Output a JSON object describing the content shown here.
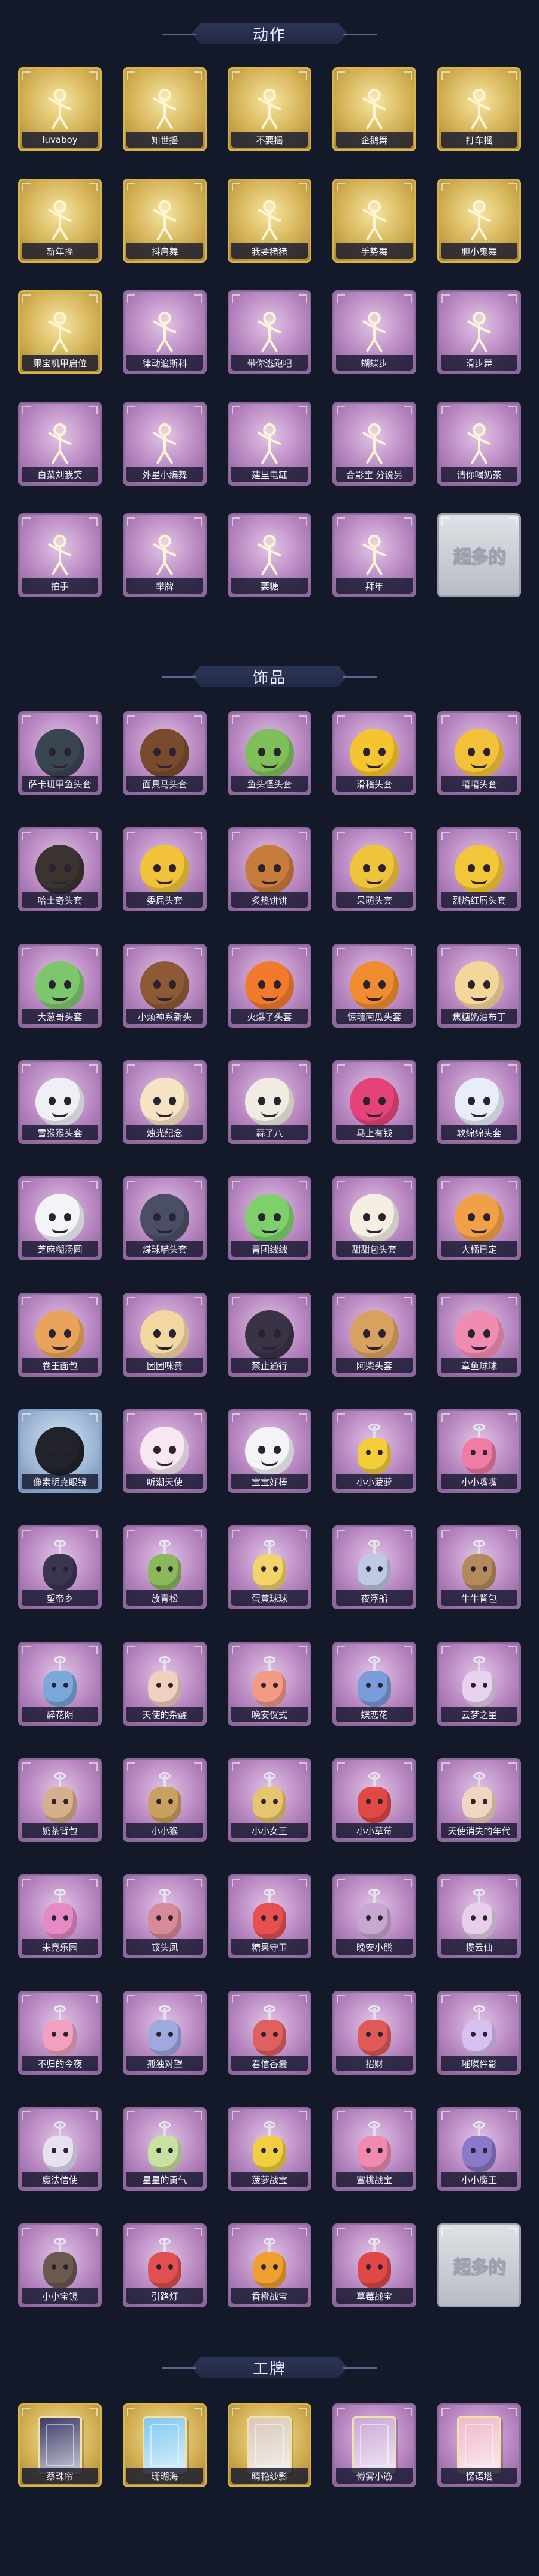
{
  "sections": {
    "actions": {
      "title": "动作",
      "items": [
        {
          "label": "luvaboy",
          "style": "gold",
          "icon": "figure-icon"
        },
        {
          "label": "知世摇",
          "style": "gold",
          "icon": "figure-icon"
        },
        {
          "label": "不要摇",
          "style": "gold",
          "icon": "figure-icon"
        },
        {
          "label": "企鹅舞",
          "style": "gold",
          "icon": "figure-icon"
        },
        {
          "label": "打车摇",
          "style": "gold",
          "icon": "figure-icon"
        },
        {
          "label": "新年摇",
          "style": "gold",
          "icon": "figure-icon"
        },
        {
          "label": "抖肩舞",
          "style": "gold",
          "icon": "figure-icon"
        },
        {
          "label": "我要猪猪",
          "style": "gold",
          "icon": "figure-icon"
        },
        {
          "label": "手势舞",
          "style": "gold",
          "icon": "figure-icon"
        },
        {
          "label": "胆小鬼舞",
          "style": "gold",
          "icon": "figure-icon"
        },
        {
          "label": "果宝机甲启位",
          "style": "gold",
          "icon": "figure-icon"
        },
        {
          "label": "律动追斯科",
          "style": "purple",
          "icon": "figure-icon"
        },
        {
          "label": "带你逃跑吧",
          "style": "purple",
          "icon": "figure-icon"
        },
        {
          "label": "蝴蝶步",
          "style": "purple",
          "icon": "figure-icon"
        },
        {
          "label": "滑步舞",
          "style": "purple",
          "icon": "figure-icon"
        },
        {
          "label": "白菜刘我笑",
          "style": "purple",
          "icon": "figure-icon"
        },
        {
          "label": "外星小编舞",
          "style": "purple",
          "icon": "figure-icon"
        },
        {
          "label": "建里电缸",
          "style": "purple",
          "icon": "figure-icon"
        },
        {
          "label": "合影宝 分说另",
          "style": "purple",
          "icon": "figure-icon"
        },
        {
          "label": "请你喝奶茶",
          "style": "purple",
          "icon": "figure-icon"
        },
        {
          "label": "拍手",
          "style": "purple",
          "icon": "figure-icon"
        },
        {
          "label": "举牌",
          "style": "purple",
          "icon": "figure-icon"
        },
        {
          "label": "要糖",
          "style": "purple",
          "icon": "figure-icon"
        },
        {
          "label": "拜年",
          "style": "purple",
          "icon": "figure-icon"
        },
        {
          "label": "",
          "style": "placeholder",
          "icon": "placeholder",
          "placeholder_text": "超多的"
        }
      ]
    },
    "accessories": {
      "title": "饰品",
      "items": [
        {
          "label": "萨卡班甲鱼头套",
          "style": "purple",
          "icon": "head",
          "color": "#3a4552"
        },
        {
          "label": "面具马头套",
          "style": "purple",
          "icon": "head",
          "color": "#7a4a2e"
        },
        {
          "label": "鱼头怪头套",
          "style": "purple",
          "icon": "head",
          "color": "#7fbf5a"
        },
        {
          "label": "滑稽头套",
          "style": "purple",
          "icon": "head",
          "color": "#f4c531"
        },
        {
          "label": "嘻嘻头套",
          "style": "purple",
          "icon": "head",
          "color": "#f2c23a"
        },
        {
          "label": "哈士奇头套",
          "style": "purple",
          "icon": "head",
          "color": "#3b3330"
        },
        {
          "label": "委屈头套",
          "style": "purple",
          "icon": "head",
          "color": "#f1c23a"
        },
        {
          "label": "炙热饼饼",
          "style": "purple",
          "icon": "head",
          "color": "#c77b3c"
        },
        {
          "label": "呆萌头套",
          "style": "purple",
          "icon": "head",
          "color": "#f0c33c"
        },
        {
          "label": "烈焰红唇头套",
          "style": "purple",
          "icon": "head",
          "color": "#f3c63a"
        },
        {
          "label": "大葱哥头套",
          "style": "purple",
          "icon": "head",
          "color": "#7ec66b"
        },
        {
          "label": "小烦神系新头",
          "style": "purple",
          "icon": "head",
          "color": "#8e5a36"
        },
        {
          "label": "火爆了头套",
          "style": "purple",
          "icon": "head",
          "color": "#f17a2c"
        },
        {
          "label": "惊魂南瓜头套",
          "style": "purple",
          "icon": "head",
          "color": "#ee8c2f"
        },
        {
          "label": "焦糖奶油布丁",
          "style": "purple",
          "icon": "head",
          "color": "#f4d59a"
        },
        {
          "label": "雪猴猴头套",
          "style": "purple",
          "icon": "head",
          "color": "#eef0f5"
        },
        {
          "label": "烛光纪念",
          "style": "purple",
          "icon": "head",
          "color": "#f6e3c4"
        },
        {
          "label": "蒜了八",
          "style": "purple",
          "icon": "head",
          "color": "#f1ece1"
        },
        {
          "label": "马上有钱",
          "style": "purple",
          "icon": "head",
          "color": "#e6427a"
        },
        {
          "label": "软绵绵头套",
          "style": "purple",
          "icon": "head",
          "color": "#e8eef8"
        },
        {
          "label": "芝麻糊汤圆",
          "style": "purple",
          "icon": "head",
          "color": "#f2f4f8"
        },
        {
          "label": "煤球喵头套",
          "style": "purple",
          "icon": "head",
          "color": "#4a4f66"
        },
        {
          "label": "青团绒绒",
          "style": "purple",
          "icon": "head",
          "color": "#7ed16a"
        },
        {
          "label": "甜甜包头套",
          "style": "purple",
          "icon": "head",
          "color": "#f4efe0"
        },
        {
          "label": "大橘已定",
          "style": "purple",
          "icon": "head",
          "color": "#f0a048"
        },
        {
          "label": "卷王面包",
          "style": "purple",
          "icon": "head",
          "color": "#e9a35a"
        },
        {
          "label": "团团咪黄",
          "style": "purple",
          "icon": "head",
          "color": "#f3d7a1"
        },
        {
          "label": "禁止通行",
          "style": "purple",
          "icon": "head",
          "color": "#3a3346"
        },
        {
          "label": "阿柴头套",
          "style": "purple",
          "icon": "head",
          "color": "#d9a160"
        },
        {
          "label": "章鱼球球",
          "style": "purple",
          "icon": "head",
          "color": "#f08cb0"
        },
        {
          "label": "像素明克眼镜",
          "style": "blue",
          "icon": "head",
          "color": "#20232c"
        },
        {
          "label": "听潮天使",
          "style": "purple",
          "icon": "head",
          "color": "#f6e7f2"
        },
        {
          "label": "宝宝好棒",
          "style": "purple",
          "icon": "head",
          "color": "#f4f4f8"
        },
        {
          "label": "小小菠萝",
          "style": "purple",
          "icon": "charm",
          "color": "#f4cd3c"
        },
        {
          "label": "小小嘴嘴",
          "style": "purple",
          "icon": "charm",
          "color": "#f07ba3"
        },
        {
          "label": "望帝乡",
          "style": "purple",
          "icon": "charm",
          "color": "#3c3552"
        },
        {
          "label": "放青松",
          "style": "purple",
          "icon": "charm",
          "color": "#8bb85a"
        },
        {
          "label": "蛋黄球球",
          "style": "purple",
          "icon": "charm",
          "color": "#f3d46a"
        },
        {
          "label": "夜浮船",
          "style": "purple",
          "icon": "charm",
          "color": "#bfc9e6"
        },
        {
          "label": "牛牛背包",
          "style": "purple",
          "icon": "charm",
          "color": "#b48a5c"
        },
        {
          "label": "醉花阴",
          "style": "purple",
          "icon": "charm",
          "color": "#7aa8d8"
        },
        {
          "label": "天使的杂醒",
          "style": "purple",
          "icon": "charm",
          "color": "#f0d0c0"
        },
        {
          "label": "晚安仪式",
          "style": "purple",
          "icon": "charm",
          "color": "#f29a84"
        },
        {
          "label": "蝶恋花",
          "style": "purple",
          "icon": "charm",
          "color": "#7a9cd8"
        },
        {
          "label": "云梦之星",
          "style": "purple",
          "icon": "charm",
          "color": "#e8d2f0"
        },
        {
          "label": "奶茶背包",
          "style": "purple",
          "icon": "charm",
          "color": "#d5b08a"
        },
        {
          "label": "小小猴",
          "style": "purple",
          "icon": "charm",
          "color": "#c8a060"
        },
        {
          "label": "小小女王",
          "style": "purple",
          "icon": "charm",
          "color": "#e6c470"
        },
        {
          "label": "小小草莓",
          "style": "purple",
          "icon": "charm",
          "color": "#e04a46"
        },
        {
          "label": "天使消失的年代",
          "style": "purple",
          "icon": "charm",
          "color": "#f0d6c0"
        },
        {
          "label": "未竟乐园",
          "style": "purple",
          "icon": "charm",
          "color": "#e58ac4"
        },
        {
          "label": "钗头凤",
          "style": "purple",
          "icon": "charm",
          "color": "#d68a9a"
        },
        {
          "label": "糖果守卫",
          "style": "purple",
          "icon": "charm",
          "color": "#e85050"
        },
        {
          "label": "晚安小熊",
          "style": "purple",
          "icon": "charm",
          "color": "#c8a8d0"
        },
        {
          "label": "揽云仙",
          "style": "purple",
          "icon": "charm",
          "color": "#e6d0e8"
        },
        {
          "label": "不归的今夜",
          "style": "purple",
          "icon": "charm",
          "color": "#f2a0c0"
        },
        {
          "label": "孤独对望",
          "style": "purple",
          "icon": "charm",
          "color": "#a0a8e0"
        },
        {
          "label": "春信香囊",
          "style": "purple",
          "icon": "charm",
          "color": "#e06060"
        },
        {
          "label": "招财",
          "style": "purple",
          "icon": "charm",
          "color": "#e05a5a"
        },
        {
          "label": "璀璨件影",
          "style": "purple",
          "icon": "charm",
          "color": "#d8c0f0"
        },
        {
          "label": "魔法信使",
          "style": "purple",
          "icon": "charm",
          "color": "#e6e0f0"
        },
        {
          "label": "星星的勇气",
          "style": "purple",
          "icon": "charm",
          "color": "#c8e0a0"
        },
        {
          "label": "菠萝战宝",
          "style": "purple",
          "icon": "charm",
          "color": "#f0d040"
        },
        {
          "label": "蜜桃战宝",
          "style": "purple",
          "icon": "charm",
          "color": "#f08ab0"
        },
        {
          "label": "小小魔王",
          "style": "purple",
          "icon": "charm",
          "color": "#8a78c8"
        },
        {
          "label": "小小宝镜",
          "style": "purple",
          "icon": "charm",
          "color": "#6a5a50"
        },
        {
          "label": "引路灯",
          "style": "purple",
          "icon": "charm",
          "color": "#e05050"
        },
        {
          "label": "香橙战宝",
          "style": "purple",
          "icon": "charm",
          "color": "#f0a030"
        },
        {
          "label": "草莓战宝",
          "style": "purple",
          "icon": "charm",
          "color": "#e04848"
        },
        {
          "label": "",
          "style": "placeholder",
          "icon": "placeholder",
          "placeholder_text": "超多的"
        }
      ]
    },
    "badges": {
      "title": "工牌",
      "items": [
        {
          "label": "蔡珠帘",
          "style": "gold",
          "icon": "card",
          "color": "#3a3a6a"
        },
        {
          "label": "珊瑚海",
          "style": "gold",
          "icon": "card",
          "color": "#7ec8f0"
        },
        {
          "label": "晴艳纱影",
          "style": "gold",
          "icon": "card",
          "color": "#d8c8b8"
        },
        {
          "label": "傅雾小筋",
          "style": "purple",
          "icon": "card",
          "color": "#c8a8d8"
        },
        {
          "label": "愣语塔",
          "style": "purple",
          "icon": "card",
          "color": "#f0b8c8"
        }
      ]
    }
  },
  "colors": {
    "background": "#14192a",
    "gold_frame": "#d8b44a",
    "purple_frame": "#8b6a9c",
    "label_bg": "#161830",
    "title_text": "#e8ecff"
  }
}
